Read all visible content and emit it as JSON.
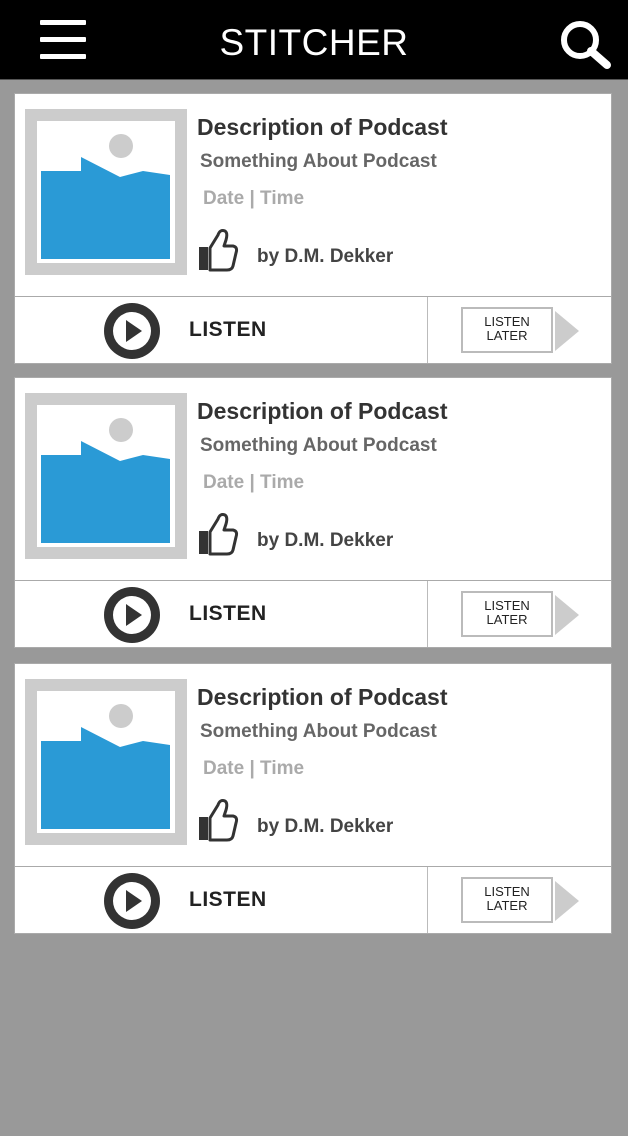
{
  "app": {
    "title": "STITCHER"
  },
  "colors": {
    "topbar": "#000000",
    "background": "#999999",
    "accent_image": "#2a9ad6",
    "play_button": "#333333"
  },
  "icons": {
    "menu": "hamburger-menu-icon",
    "search": "search-icon",
    "like": "thumbs-up-icon",
    "play": "play-icon",
    "image_placeholder": "image-placeholder-icon",
    "later_arrow": "arrow-right-icon"
  },
  "podcasts": [
    {
      "title": "Description of Podcast",
      "subtitle": "Something About Podcast",
      "datetime": "Date | Time",
      "author": "by D.M. Dekker",
      "listen_label": "LISTEN",
      "later_label_line1": "LISTEN",
      "later_label_line2": "LATER"
    },
    {
      "title": "Description of Podcast",
      "subtitle": "Something About Podcast",
      "datetime": "Date | Time",
      "author": "by D.M. Dekker",
      "listen_label": "LISTEN",
      "later_label_line1": "LISTEN",
      "later_label_line2": "LATER"
    },
    {
      "title": "Description of Podcast",
      "subtitle": "Something About Podcast",
      "datetime": "Date | Time",
      "author": "by D.M. Dekker",
      "listen_label": "LISTEN",
      "later_label_line1": "LISTEN",
      "later_label_line2": "LATER"
    }
  ]
}
